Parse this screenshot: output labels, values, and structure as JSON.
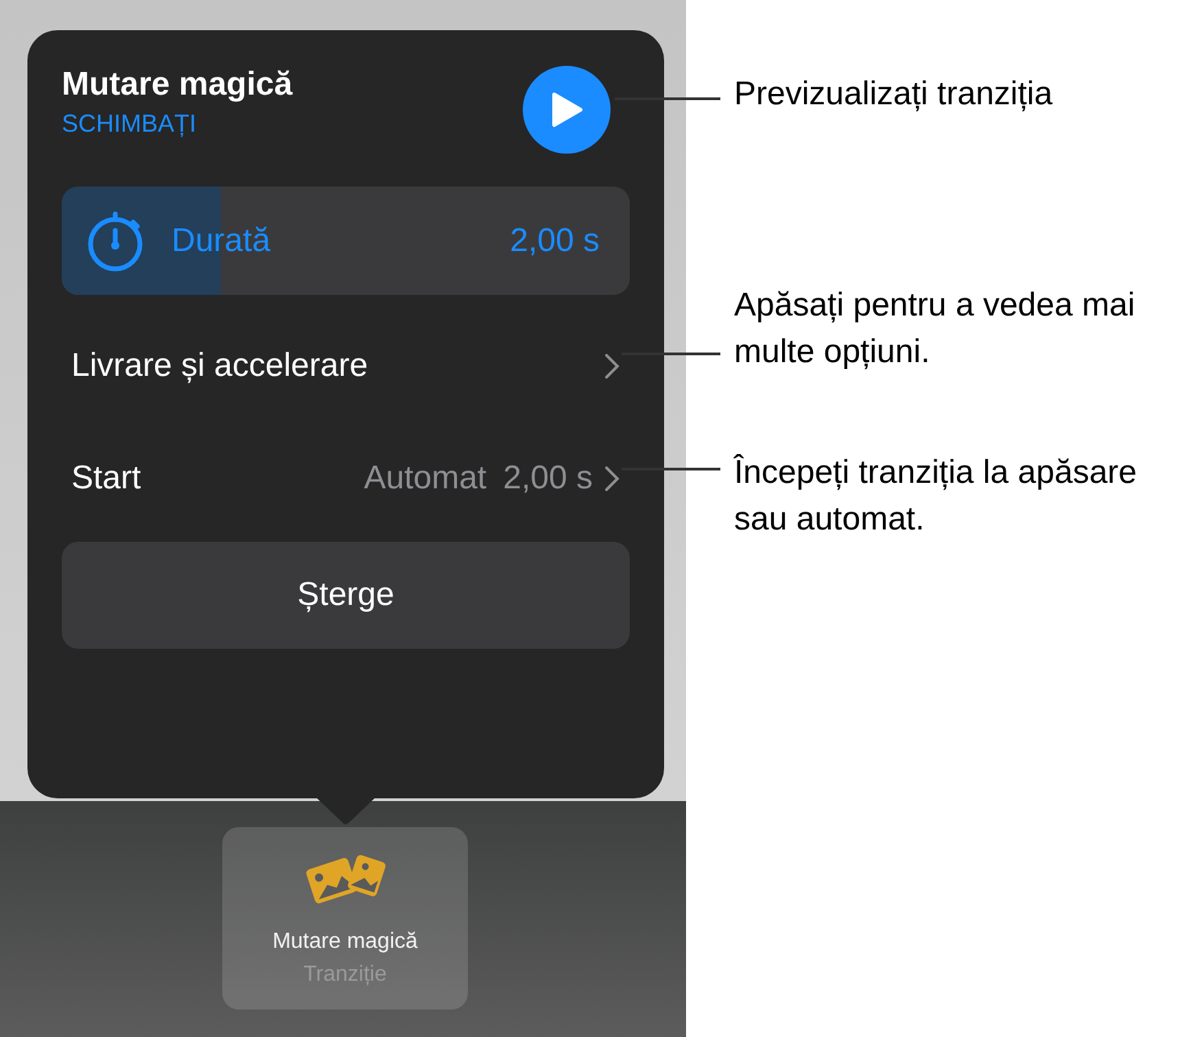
{
  "popover": {
    "title": "Mutare magică",
    "subtitle": "SCHIMBAȚI",
    "duration": {
      "label": "Durată",
      "value": "2,00 s",
      "level": 0.28
    },
    "rows": [
      {
        "label": "Livrare și accelerare"
      },
      {
        "label": "Start",
        "detail": "Automat",
        "value": "2,00 s"
      }
    ],
    "delete_button": "Șterge"
  },
  "tile": {
    "title": "Mutare magică",
    "subtitle": "Tranziție",
    "selected": true
  },
  "callouts": [
    {
      "text": "Previzualizați tranziția"
    },
    {
      "text": "Apăsați pentru a vedea mai multe opțiuni."
    },
    {
      "text": "Începeți tranziția la apăsare sau automat."
    }
  ]
}
